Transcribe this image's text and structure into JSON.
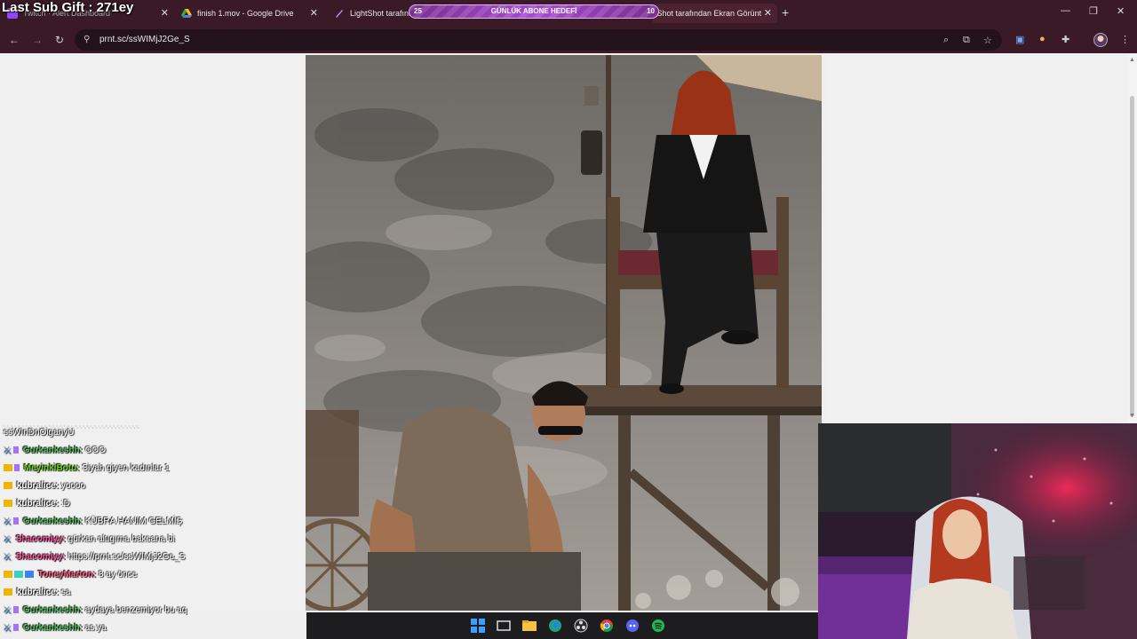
{
  "overlay": {
    "last_sub_gift": "Last Sub Gift : 271ey",
    "goal": {
      "label": "GÜNLÜK ABONE HEDEFİ",
      "current": "25",
      "target": "10"
    }
  },
  "browser": {
    "tabs": [
      {
        "title": "Twitch · Alert Dashboard",
        "icon": "twitch-icon"
      },
      {
        "title": "finish 1.mov - Google Drive",
        "icon": "google-drive-icon"
      },
      {
        "title": "LightShot tarafından",
        "icon": "lightshot-icon"
      },
      {
        "title": "tShot tarafından Ekran Görünt",
        "icon": "lightshot-icon"
      }
    ],
    "address": {
      "url": "prnt.sc/ssWIMjJ2Ge_S"
    }
  },
  "chat": {
    "messages": [
      {
        "user": "",
        "text": "ssWInDnOiganyU",
        "user_color": "#ffffff"
      },
      {
        "user": "Gurkankeshh:",
        "text": "OOO",
        "user_color": "#4fbf5a"
      },
      {
        "user": "MeyinkiBotu:",
        "text": "Siyah giyen kadınlar 1",
        "user_color": "#6bd11f"
      },
      {
        "user": "kubralice:",
        "text": "yoooo",
        "user_color": "#ffffff"
      },
      {
        "user": "kubralice:",
        "text": ":D",
        "user_color": "#ffffff"
      },
      {
        "user": "Gurkankeshh:",
        "text": "KÜBRA HANIM GELMİŞ",
        "user_color": "#4fbf5a"
      },
      {
        "user": "Shacomiyy:",
        "text": "gürkan altıgıma baksana bi",
        "user_color": "#ff4f9a"
      },
      {
        "user": "Shacomiyy:",
        "text": "https://prnt.sc/ssWIMjJ2Ge_S",
        "user_color": "#ff4f9a"
      },
      {
        "user": "ToneyMarton:",
        "text": "8 ay önce",
        "user_color": "#ff5a8a"
      },
      {
        "user": "kubralice:",
        "text": "sa",
        "user_color": "#ffffff"
      },
      {
        "user": "Gurkankeshh:",
        "text": "aydaya benzemiyor bu aq",
        "user_color": "#4fbf5a"
      },
      {
        "user": "Gurkankeshh:",
        "text": "as ya",
        "user_color": "#4fbf5a"
      }
    ]
  },
  "colors": {
    "browser_frame": "#3a1a26",
    "goal_bar": "#a64bd1",
    "page_bg": "#efefef"
  }
}
